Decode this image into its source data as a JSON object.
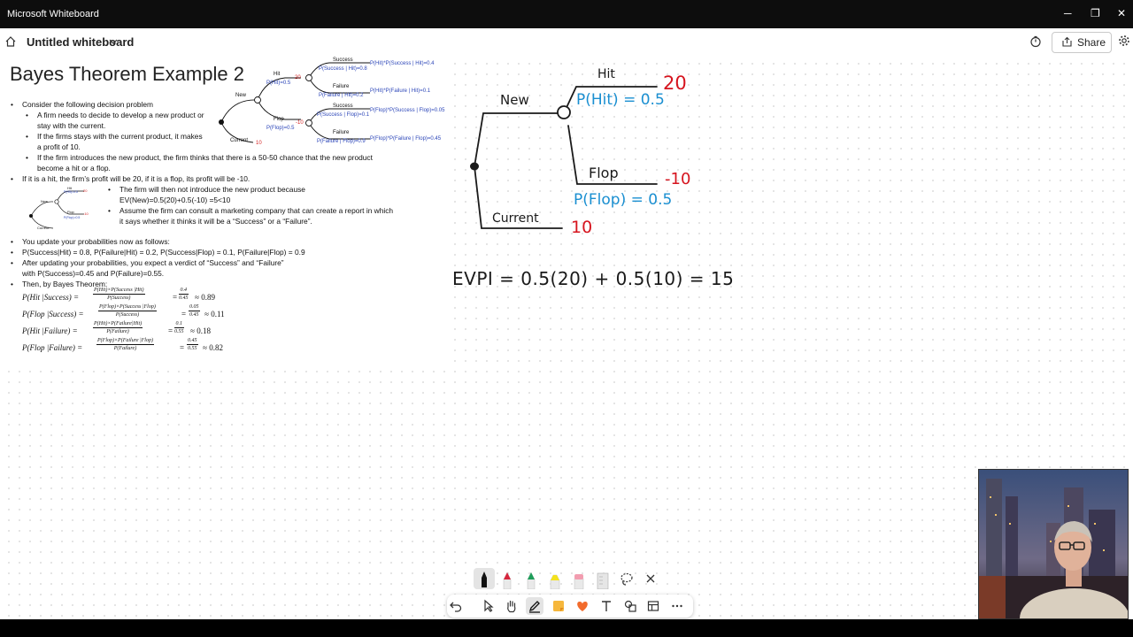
{
  "window": {
    "app_title": "Microsoft Whiteboard",
    "minimize": "─",
    "restore": "❐",
    "close": "✕"
  },
  "header": {
    "doc_title": "Untitled whiteboard",
    "share_label": "Share"
  },
  "slide": {
    "title": "Bayes Theorem Example 2",
    "bullets": [
      "Consider the following decision problem",
      "A firm needs to decide to develop a new product or",
      "stay with the current.",
      "If the firms stays with the current product, it makes",
      "a profit of 10.",
      "If the firm introduces the new product, the firm thinks that there is a 50-50 chance that the new product",
      "become a hit or a flop.",
      "If it is a hit, the firm’s profit will be 20, if it is a flop, its profit will be -10.",
      "The firm will then not introduce the new product because",
      "EV(New)=0.5(20)+0.5(-10) =5<10",
      "Assume the firm can consult a marketing company that can create a report in which",
      "it says whether it thinks it will be a “Success” or a “Failure”.",
      "You update your probabilities now as follows:",
      "P(Success|Hit) = 0.8, P(Failure|Hit) = 0.2, P(Success|Flop) = 0.1, P(Failure|Flop) = 0.9",
      "After updating your probabilities, you expect a verdict of “Success” and “Failure”",
      "with  P(Success)=0.45 and P(Failure)=0.55.",
      "Then, by Bayes Theorem:"
    ],
    "equations": [
      {
        "lhs": "P(Hit |Success) =",
        "num": "P(Hit)×P(Success |Hit)",
        "den": "P(Success)",
        "num2": "0.4",
        "den2": "0.45",
        "approx": "≈ 0.89"
      },
      {
        "lhs": "P(Flop |Success) =",
        "num": "P(Flop)×P(Success |Flop)",
        "den": "P(Success)",
        "num2": "0.05",
        "den2": "0.45",
        "approx": "≈ 0.11"
      },
      {
        "lhs": "P(Hit |Failure) =",
        "num": "P(Hit)×P(Failure|Hit)",
        "den": "P(Failure)",
        "num2": "0.1",
        "den2": "0.55",
        "approx": "≈ 0.18"
      },
      {
        "lhs": "P(Flop |Failure) =",
        "num": "P(Flop)×P(Failure |Flop)",
        "den": "P(Failure)",
        "num2": "0.45",
        "den2": "0.55",
        "approx": "≈ 0.82"
      }
    ],
    "big_tree": {
      "new": "New",
      "current": "Current",
      "current_value": "10",
      "hit": "Hit",
      "p_hit": "P(Hit)=0.5",
      "hit_value": "20",
      "flop": "Flop",
      "p_flop": "P(Flop)=0.5",
      "flop_value": "-10",
      "success1": "Success",
      "p_success_hit": "P(Success | Hit)=0.8",
      "out1": "P(Hit)*P(Success | Hit)=0.4",
      "failure1": "Failure",
      "p_failure_hit": "P(Failure | Hit)=0.2",
      "out2": "P(Hit)*P(Failure | Hit)=0.1",
      "success2": "Success",
      "p_success_flop": "P(Success | Flop)=0.1",
      "out3": "P(Flop)*P(Success | Flop)=0.05",
      "failure2": "Failure",
      "p_failure_flop": "P(Failure | Flop)=0.9",
      "out4": "P(Flop)*P(Failure | Flop)=0.45"
    },
    "small_tree": {
      "new": "New",
      "hit": "Hit",
      "flop": "Flop",
      "p_hit": "P(Hit)=0.5",
      "p_flop": "P(Flop)=0.5",
      "current": "Current",
      "hit_value": "20",
      "flop_value": "-10"
    }
  },
  "handwriting": {
    "new": "New",
    "hit": "Hit",
    "hit_value": "20",
    "p_hit": "P(Hit) = 0.5",
    "flop": "Flop",
    "flop_value": "-10",
    "p_flop": "P(Flop) = 0.5",
    "current": "Current",
    "current_value": "10",
    "evpi": "EVPI = 0.5(20) + 0.5(10) = 15"
  },
  "colors": {
    "ink_black": "#1a1a1a",
    "ink_red": "#d6141e",
    "ink_blue": "#1a8fd1",
    "slide_blue": "#2b45b8",
    "slide_red": "#d62828"
  },
  "icons": {
    "pens": [
      "black-pen-icon",
      "red-pen-icon",
      "green-pen-icon",
      "yellow-highlighter-icon",
      "pink-eraser-icon",
      "ruler-icon",
      "lasso-icon",
      "close-icon"
    ],
    "tools": [
      "undo-icon",
      "select-icon",
      "pan-hand-icon",
      "inking-icon",
      "sticky-note-icon",
      "reactions-heart-icon",
      "text-icon",
      "shapes-icon",
      "templates-icon",
      "more-icon"
    ]
  }
}
